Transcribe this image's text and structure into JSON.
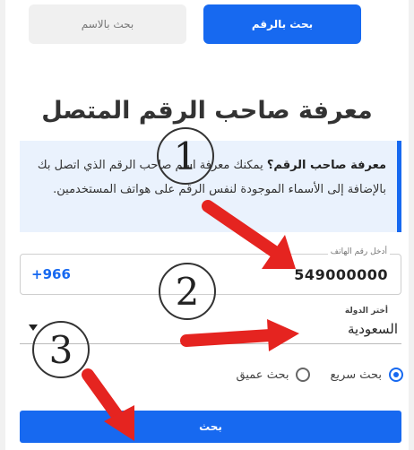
{
  "tabs": {
    "by_number": "بحث بالرقم",
    "by_name": "بحث بالاسم"
  },
  "title": "معرفة صاحب الرقم المتصل",
  "info": {
    "lead": "معرفة صاحب الرقم؟",
    "body": " يمكنك معرفة اسم صاحب الرقم الذي اتصل بك بالإضافة إلى الأسماء الموجودة لنفس الرقم على هواتف المستخدمين."
  },
  "phone": {
    "label": "أدخل رقم الهاتف",
    "value": "549000000",
    "prefix": "+966"
  },
  "country": {
    "label": "أختر الدولة",
    "value": "السعودية"
  },
  "search_type": {
    "fast": "بحث سريع",
    "deep": "بحث عميق",
    "selected": "fast"
  },
  "search_button": "بحث",
  "annotations": [
    "1",
    "2",
    "3"
  ],
  "colors": {
    "primary": "#1769f0",
    "arrow": "#e52420",
    "info_bg": "#eaf2fd"
  }
}
